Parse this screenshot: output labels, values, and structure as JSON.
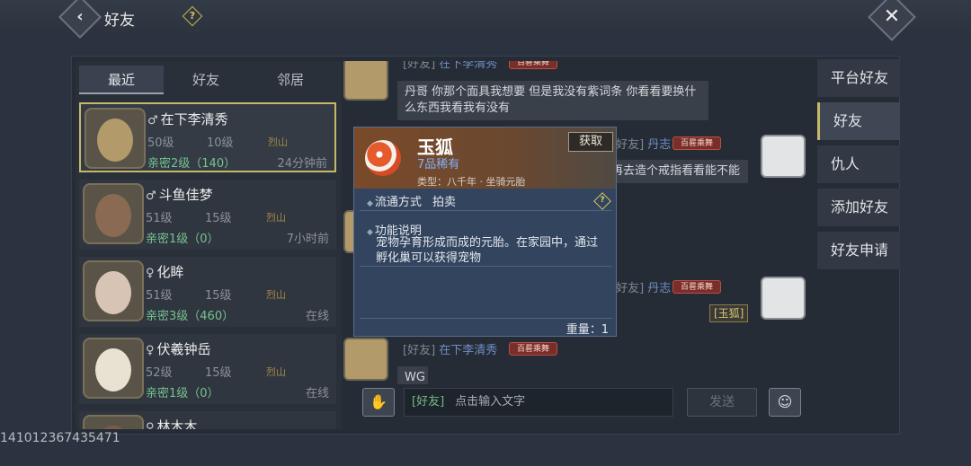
{
  "header": {
    "title": "好友",
    "help": "?",
    "back": "‹",
    "close": "✕"
  },
  "left_tabs": [
    "最近",
    "好友",
    "邻居"
  ],
  "friends": [
    {
      "gender": "♂",
      "name": "在下李清秀",
      "level": "50级",
      "level2": "10级",
      "clan": "烈山",
      "intimacy": "亲密2级（140）",
      "status": "24分钟前",
      "avatar_color": "#b29a6a"
    },
    {
      "gender": "♂",
      "name": "斗鱼佳梦",
      "level": "51级",
      "level2": "15级",
      "clan": "烈山",
      "intimacy": "亲密1级（0）",
      "status": "7小时前",
      "avatar_color": "#8a6a52"
    },
    {
      "gender": "♀",
      "name": "化眸",
      "level": "51级",
      "level2": "15级",
      "clan": "烈山",
      "intimacy": "亲密3级（460）",
      "status": "在线",
      "avatar_color": "#d8c4b4"
    },
    {
      "gender": "♀",
      "name": "伏羲钟岳",
      "level": "52级",
      "level2": "15级",
      "clan": "烈山",
      "intimacy": "亲密1级（0）",
      "status": "在线",
      "avatar_color": "#e8e2d2"
    },
    {
      "gender": "♀",
      "name": "林木木",
      "level": "",
      "level2": "",
      "clan": "",
      "intimacy": "",
      "status": "",
      "avatar_color": "#7a5a48"
    }
  ],
  "chat": {
    "messages": [
      {
        "tag": "[好友]",
        "sender": "在下李清秀",
        "badge": "百晷乘舞",
        "text": "丹哥 你那个面具我想要 但是我没有紫词条 你看看要换什么东西我看我有没有"
      },
      {
        "tag": "[好友]",
        "sender": "丹志",
        "badge": "百晷乘舞",
        "text": "再去造个戒指看看能不能"
      },
      {
        "tag": "[好友]",
        "sender": "丹志",
        "badge": "百晷乘舞",
        "text": "[玉狐]"
      },
      {
        "tag": "[好友]",
        "sender": "在下李清秀",
        "badge": "百晷乘舞",
        "text": "WG"
      }
    ],
    "input": {
      "channel": "[好友]",
      "placeholder": "点击输入文字"
    },
    "send_label": "发送"
  },
  "right_menu": [
    "平台好友",
    "好友",
    "仇人",
    "添加好友",
    "好友申请"
  ],
  "item_popup": {
    "name": "玉狐",
    "grade": "7品稀有",
    "type": "类型：八千年 · 坐骑元胎",
    "obtain": "获取",
    "trade_label": "流通方式",
    "trade_value": "拍卖",
    "func_label": "功能说明",
    "func_desc": "宠物孕育形成而成的元胎。在家园中，通过孵化巢可以获得宠物",
    "weight": "重量：1"
  },
  "footer_id": "141012367435471"
}
